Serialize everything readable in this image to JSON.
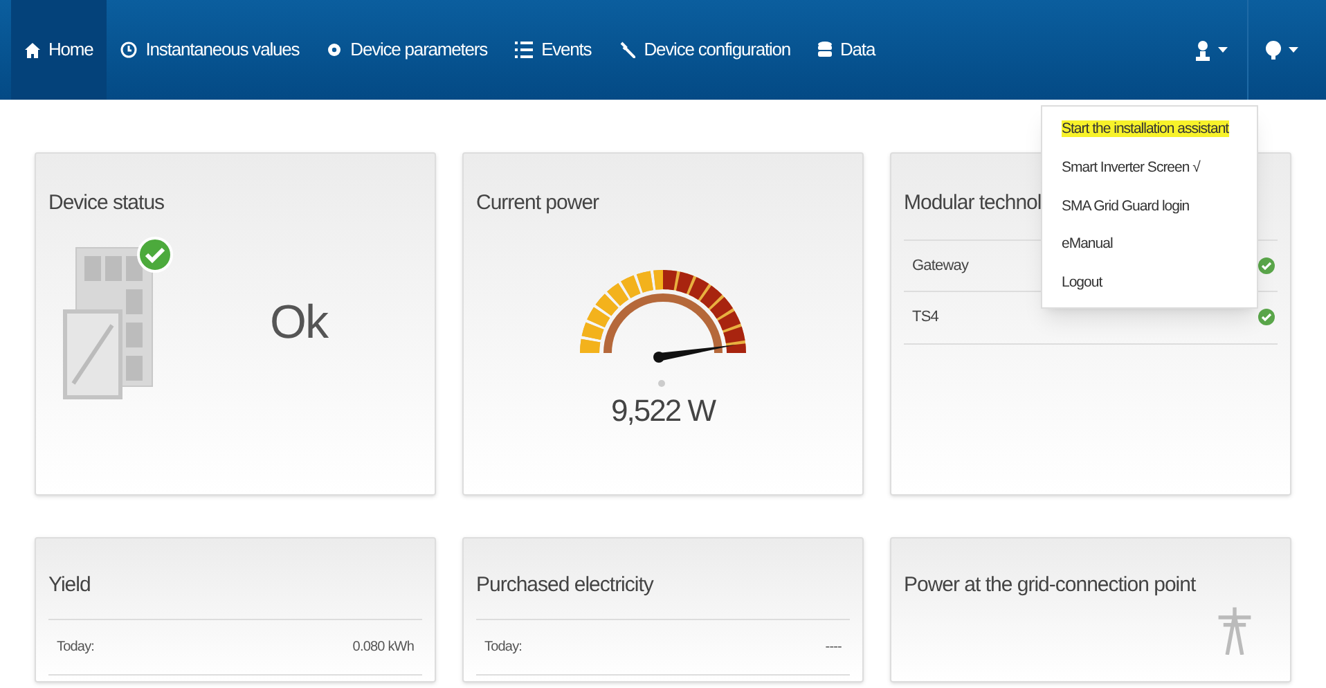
{
  "nav": {
    "items": [
      {
        "label": "Home",
        "selected": true
      },
      {
        "label": "Instantaneous values",
        "selected": false
      },
      {
        "label": "Device parameters",
        "selected": false
      },
      {
        "label": "Events",
        "selected": false
      },
      {
        "label": "Device configuration",
        "selected": false
      },
      {
        "label": "Data",
        "selected": false
      }
    ]
  },
  "user_menu": {
    "items": [
      {
        "label": "Start the installation assistant",
        "highlighted": true
      },
      {
        "label": "Smart Inverter Screen √",
        "highlighted": false
      },
      {
        "label": "SMA Grid Guard login",
        "highlighted": false
      },
      {
        "label": "eManual",
        "highlighted": false
      },
      {
        "label": "Logout",
        "highlighted": false
      }
    ]
  },
  "device_status": {
    "title": "Device status",
    "status": "Ok"
  },
  "current_power": {
    "title": "Current power",
    "value": "9,522 W"
  },
  "modular_technology": {
    "title": "Modular technol",
    "rows": [
      {
        "name": "Gateway"
      },
      {
        "name": "TS4"
      }
    ]
  },
  "yield": {
    "title": "Yield",
    "rows": [
      {
        "label": "Today:",
        "value": "0.080 kWh"
      }
    ]
  },
  "purchased_electricity": {
    "title": "Purchased electricity",
    "rows": [
      {
        "label": "Today:",
        "value": "----"
      }
    ]
  },
  "grid_connection": {
    "title": "Power at the grid-connection point"
  }
}
